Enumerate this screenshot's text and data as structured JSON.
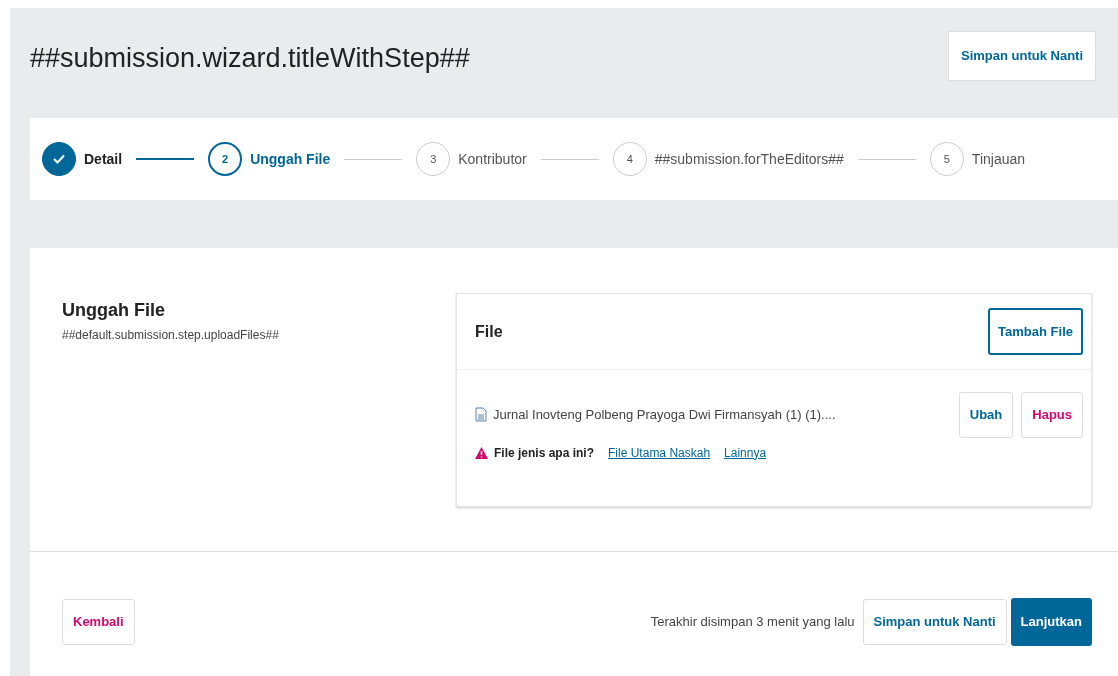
{
  "header": {
    "title": "##submission.wizard.titleWithStep##",
    "save_button": "Simpan untuk Nanti"
  },
  "steps": [
    {
      "label": "Detail",
      "completed": true,
      "selected": false
    },
    {
      "number": "2",
      "label": "Unggah File",
      "completed": false,
      "selected": true
    },
    {
      "number": "3",
      "label": "Kontributor",
      "completed": false,
      "selected": false
    },
    {
      "number": "4",
      "label": "##submission.forTheEditors##",
      "completed": false,
      "selected": false
    },
    {
      "number": "5",
      "label": "Tinjauan",
      "completed": false,
      "selected": false
    }
  ],
  "section": {
    "title": "Unggah File",
    "description": "##default.submission.step.uploadFiles##"
  },
  "file_panel": {
    "title": "File",
    "add_button": "Tambah File",
    "files": [
      {
        "name": "Jurnal Inovteng Polbeng Prayoga Dwi Firmansyah (1) (1)....",
        "edit_button": "Ubah",
        "delete_button": "Hapus",
        "warning": "File jenis apa ini?",
        "genre_options": [
          "File Utama Naskah",
          "Lainnya"
        ]
      }
    ]
  },
  "footer": {
    "back_button": "Kembali",
    "last_saved": "Terakhir disimpan 3 menit yang lalu",
    "save_button": "Simpan untuk Nanti",
    "continue_button": "Lanjutkan"
  }
}
